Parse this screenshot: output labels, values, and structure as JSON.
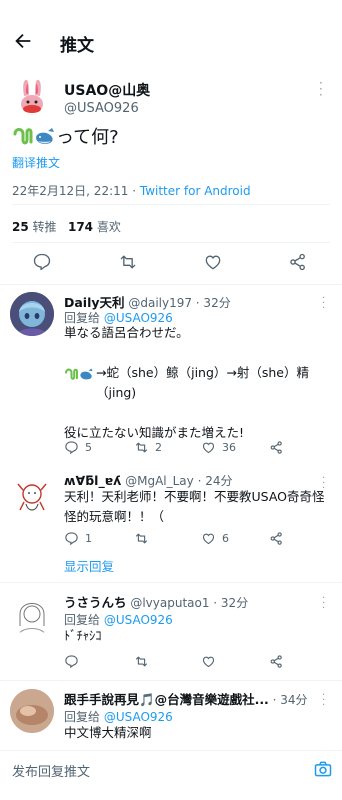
{
  "header": {
    "title": "推文"
  },
  "tweet": {
    "display_name": "USAO@山奥",
    "handle": "@USAO926",
    "text": "って何?",
    "translate": "翻译推文",
    "time": "22年2月12日, 22:11 · ",
    "source": "Twitter for Android",
    "retweets": "25",
    "retweets_label": " 转推",
    "likes": "174",
    "likes_label": " 喜欢"
  },
  "replies": [
    {
      "name": "Daily天利",
      "meta": " @daily197 · 32分",
      "reply_to_label": "回复给 ",
      "reply_to": "@USAO926",
      "line1": "単なる語呂合わせだ。",
      "line2": "→蛇（she）鲸（jing）→射（she）精（jing)",
      "line3": "役に立たない知識がまた増えた!",
      "comments": "5",
      "retweets": "2",
      "likes": "36"
    },
    {
      "name": "ʍ∀ƃl_ɐʎ",
      "meta": " @MgAl_Lay · 24分",
      "text": "天利！天利老师！不要啊！不要教USAO奇奇怪怪的玩意啊！！（",
      "comments": "1",
      "retweets": "",
      "likes": "6",
      "show_replies": "显示回复"
    },
    {
      "name": "うさうんち",
      "meta": " @lvyaputao1 · 32分",
      "reply_to_label": "回复给 ",
      "reply_to": "@USAO926",
      "text": "ﾄﾞﾁｬｼｺ"
    },
    {
      "name": "跟手手說再見🎵@台灣音樂遊戲社...",
      "meta": " · 34分",
      "reply_to_label": "回复给 ",
      "reply_to": "@USAO926",
      "text": "中文博大精深啊"
    }
  ],
  "composer": {
    "placeholder": "发布回复推文"
  }
}
